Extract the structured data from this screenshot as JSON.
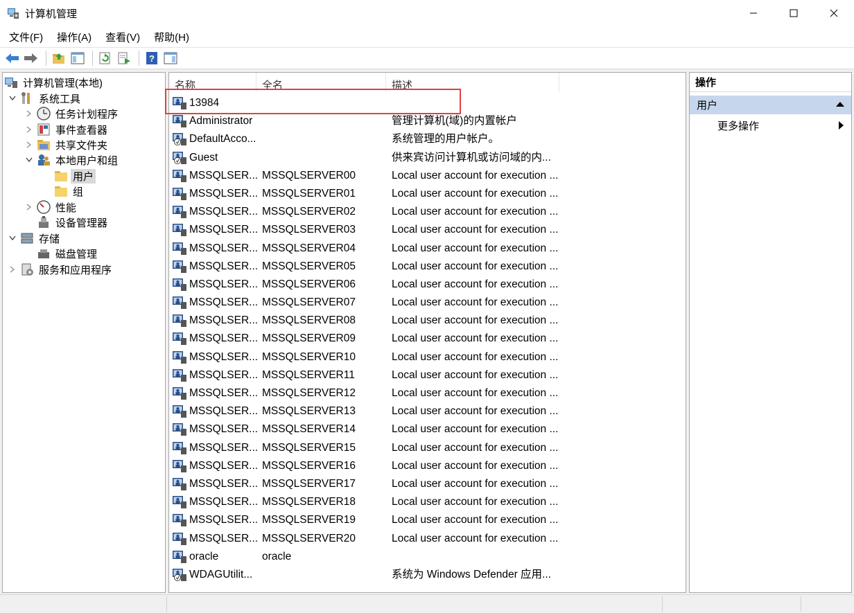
{
  "window": {
    "title": "计算机管理"
  },
  "menu": [
    "文件(F)",
    "操作(A)",
    "查看(V)",
    "帮助(H)"
  ],
  "toolbar": {
    "buttons": [
      "back-arrow-icon",
      "forward-arrow-icon",
      "up-folder-icon",
      "show-hide-tree-icon",
      "refresh-icon",
      "export-list-icon",
      "help-icon",
      "show-hide-action-pane-icon"
    ]
  },
  "tree": [
    {
      "label": "计算机管理(本地)",
      "icon": "computer-management-icon",
      "level": 0,
      "expander": "none"
    },
    {
      "label": "系统工具",
      "icon": "system-tools-icon",
      "level": 1,
      "expander": "expanded"
    },
    {
      "label": "任务计划程序",
      "icon": "clock-icon",
      "level": 2,
      "expander": "collapsed"
    },
    {
      "label": "事件查看器",
      "icon": "event-viewer-icon",
      "level": 2,
      "expander": "collapsed"
    },
    {
      "label": "共享文件夹",
      "icon": "shared-folder-icon",
      "level": 2,
      "expander": "collapsed"
    },
    {
      "label": "本地用户和组",
      "icon": "users-groups-icon",
      "level": 2,
      "expander": "expanded"
    },
    {
      "label": "用户",
      "icon": "folder-icon",
      "level": 3,
      "expander": "none",
      "selected": true
    },
    {
      "label": "组",
      "icon": "folder-icon",
      "level": 3,
      "expander": "none"
    },
    {
      "label": "性能",
      "icon": "performance-icon",
      "level": 2,
      "expander": "collapsed"
    },
    {
      "label": "设备管理器",
      "icon": "device-manager-icon",
      "level": 2,
      "expander": "none"
    },
    {
      "label": "存储",
      "icon": "storage-icon",
      "level": 1,
      "expander": "expanded"
    },
    {
      "label": "磁盘管理",
      "icon": "disk-management-icon",
      "level": 2,
      "expander": "none"
    },
    {
      "label": "服务和应用程序",
      "icon": "services-icon",
      "level": 1,
      "expander": "collapsed"
    }
  ],
  "list": {
    "columns": [
      "名称",
      "全名",
      "描述"
    ],
    "rows": [
      {
        "name": "13984",
        "full": "",
        "desc": "",
        "icon": "user-icon"
      },
      {
        "name": "Administrator",
        "full": "",
        "desc": "管理计算机(域)的内置帐户",
        "icon": "user-icon"
      },
      {
        "name": "DefaultAcco...",
        "full": "",
        "desc": "系统管理的用户帐户。",
        "icon": "disabled-user-icon"
      },
      {
        "name": "Guest",
        "full": "",
        "desc": "供来宾访问计算机或访问域的内...",
        "icon": "disabled-user-icon"
      },
      {
        "name": "MSSQLSER...",
        "full": "MSSQLSERVER00",
        "desc": "Local user account for execution ...",
        "icon": "user-icon"
      },
      {
        "name": "MSSQLSER...",
        "full": "MSSQLSERVER01",
        "desc": "Local user account for execution ...",
        "icon": "user-icon"
      },
      {
        "name": "MSSQLSER...",
        "full": "MSSQLSERVER02",
        "desc": "Local user account for execution ...",
        "icon": "user-icon"
      },
      {
        "name": "MSSQLSER...",
        "full": "MSSQLSERVER03",
        "desc": "Local user account for execution ...",
        "icon": "user-icon"
      },
      {
        "name": "MSSQLSER...",
        "full": "MSSQLSERVER04",
        "desc": "Local user account for execution ...",
        "icon": "user-icon"
      },
      {
        "name": "MSSQLSER...",
        "full": "MSSQLSERVER05",
        "desc": "Local user account for execution ...",
        "icon": "user-icon"
      },
      {
        "name": "MSSQLSER...",
        "full": "MSSQLSERVER06",
        "desc": "Local user account for execution ...",
        "icon": "user-icon"
      },
      {
        "name": "MSSQLSER...",
        "full": "MSSQLSERVER07",
        "desc": "Local user account for execution ...",
        "icon": "user-icon"
      },
      {
        "name": "MSSQLSER...",
        "full": "MSSQLSERVER08",
        "desc": "Local user account for execution ...",
        "icon": "user-icon"
      },
      {
        "name": "MSSQLSER...",
        "full": "MSSQLSERVER09",
        "desc": "Local user account for execution ...",
        "icon": "user-icon"
      },
      {
        "name": "MSSQLSER...",
        "full": "MSSQLSERVER10",
        "desc": "Local user account for execution ...",
        "icon": "user-icon"
      },
      {
        "name": "MSSQLSER...",
        "full": "MSSQLSERVER11",
        "desc": "Local user account for execution ...",
        "icon": "user-icon"
      },
      {
        "name": "MSSQLSER...",
        "full": "MSSQLSERVER12",
        "desc": "Local user account for execution ...",
        "icon": "user-icon"
      },
      {
        "name": "MSSQLSER...",
        "full": "MSSQLSERVER13",
        "desc": "Local user account for execution ...",
        "icon": "user-icon"
      },
      {
        "name": "MSSQLSER...",
        "full": "MSSQLSERVER14",
        "desc": "Local user account for execution ...",
        "icon": "user-icon"
      },
      {
        "name": "MSSQLSER...",
        "full": "MSSQLSERVER15",
        "desc": "Local user account for execution ...",
        "icon": "user-icon"
      },
      {
        "name": "MSSQLSER...",
        "full": "MSSQLSERVER16",
        "desc": "Local user account for execution ...",
        "icon": "user-icon"
      },
      {
        "name": "MSSQLSER...",
        "full": "MSSQLSERVER17",
        "desc": "Local user account for execution ...",
        "icon": "user-icon"
      },
      {
        "name": "MSSQLSER...",
        "full": "MSSQLSERVER18",
        "desc": "Local user account for execution ...",
        "icon": "user-icon"
      },
      {
        "name": "MSSQLSER...",
        "full": "MSSQLSERVER19",
        "desc": "Local user account for execution ...",
        "icon": "user-icon"
      },
      {
        "name": "MSSQLSER...",
        "full": "MSSQLSERVER20",
        "desc": "Local user account for execution ...",
        "icon": "user-icon"
      },
      {
        "name": "oracle",
        "full": "oracle",
        "desc": "",
        "icon": "user-icon"
      },
      {
        "name": "WDAGUtilit...",
        "full": "",
        "desc": "系统为 Windows Defender 应用...",
        "icon": "disabled-user-icon"
      }
    ]
  },
  "actions": {
    "header": "操作",
    "section": "用户",
    "more": "更多操作"
  },
  "colors": {
    "highlight_border": "#e04040",
    "action_section_bg": "#c6d6ec",
    "selected_tree_bg": "#d9d9d9"
  }
}
